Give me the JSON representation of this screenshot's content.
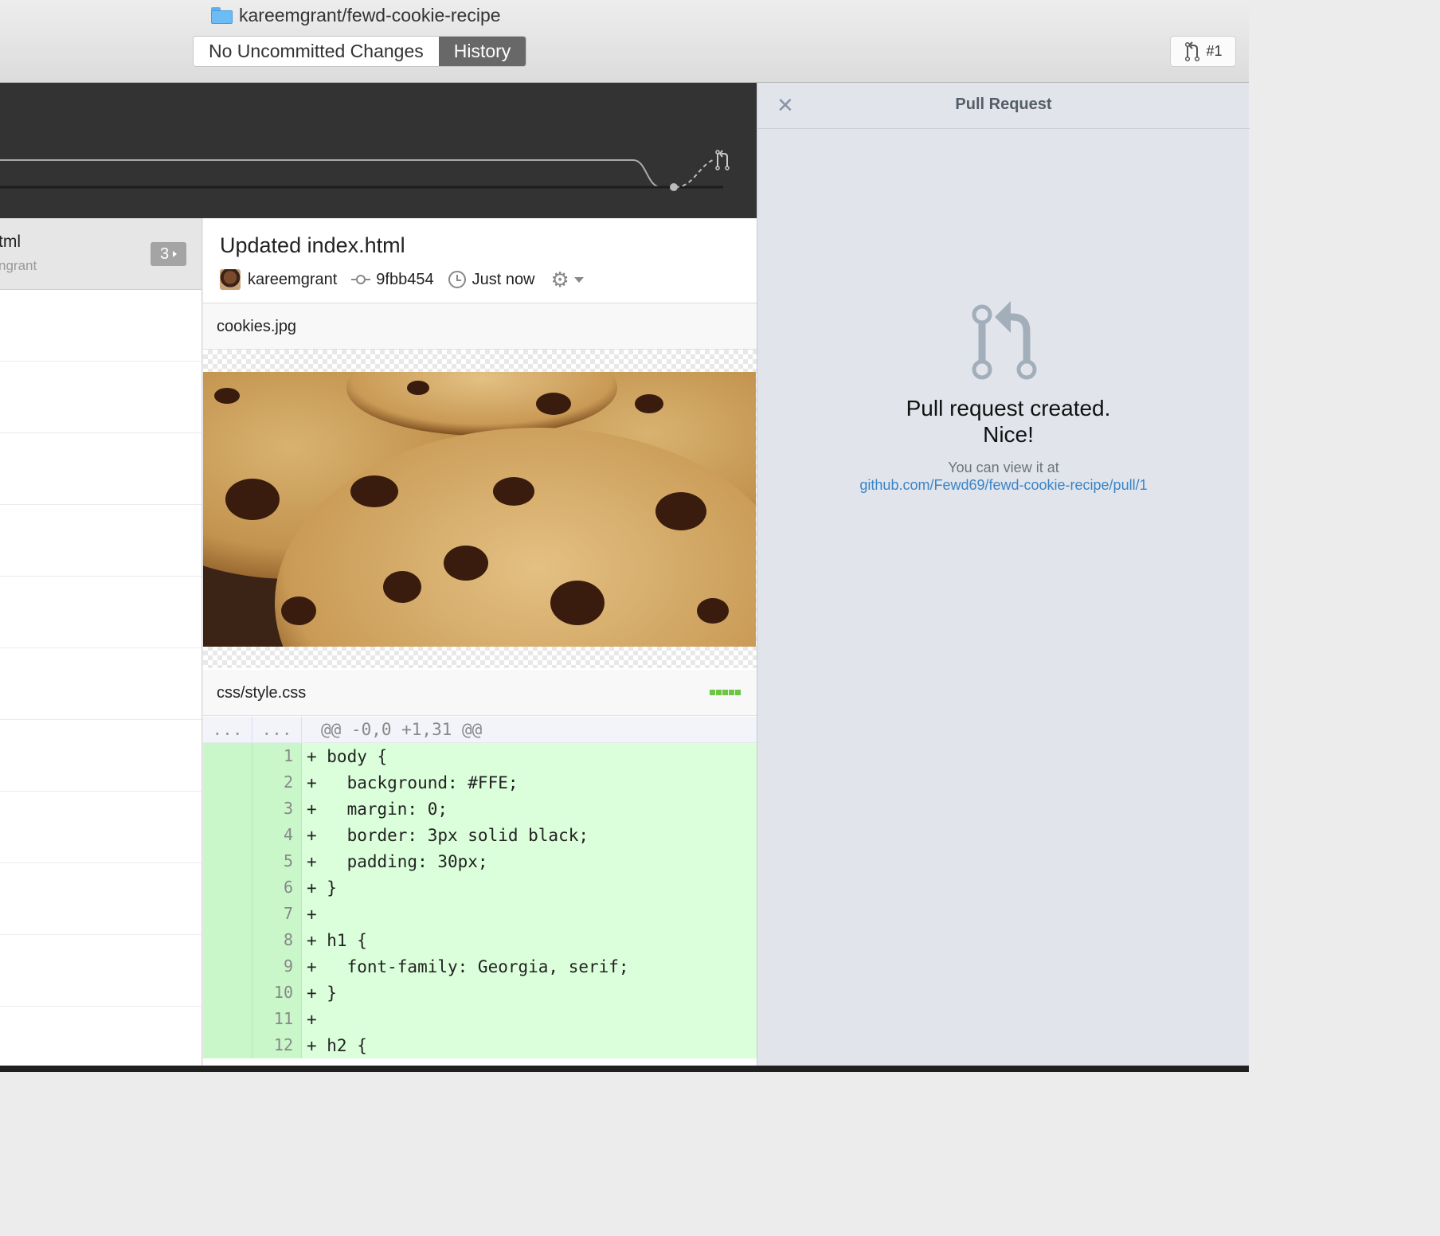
{
  "toolbar": {
    "repo_title": "kareemgrant/fewd-cookie-recipe",
    "tab_changes": "No Uncommitted Changes",
    "tab_history": "History",
    "pr_button_label": "#1"
  },
  "commit_list": {
    "selected_title": "tml",
    "selected_author": "ngrant",
    "file_count": "3"
  },
  "detail": {
    "title": "Updated index.html",
    "author": "kareemgrant",
    "sha": "9fbb454",
    "time": "Just now"
  },
  "files": [
    {
      "name": "cookies.jpg"
    },
    {
      "name": "css/style.css"
    }
  ],
  "diff": {
    "hunk_left": "...",
    "hunk_right": "...",
    "hunk_header": "@@ -0,0 +1,31 @@",
    "lines": [
      {
        "num": "1",
        "code": "+ body {"
      },
      {
        "num": "2",
        "code": "+   background: #FFE;"
      },
      {
        "num": "3",
        "code": "+   margin: 0;"
      },
      {
        "num": "4",
        "code": "+   border: 3px solid black;"
      },
      {
        "num": "5",
        "code": "+   padding: 30px;"
      },
      {
        "num": "6",
        "code": "+ }"
      },
      {
        "num": "7",
        "code": "+"
      },
      {
        "num": "8",
        "code": "+ h1 {"
      },
      {
        "num": "9",
        "code": "+   font-family: Georgia, serif;"
      },
      {
        "num": "10",
        "code": "+ }"
      },
      {
        "num": "11",
        "code": "+"
      },
      {
        "num": "12",
        "code": "+ h2 {"
      }
    ]
  },
  "pr_panel": {
    "title": "Pull Request",
    "message_line1": "Pull request created.",
    "message_line2": "Nice!",
    "sub": "You can view it at",
    "link": "github.com/Fewd69/fewd-cookie-recipe/pull/1"
  },
  "colors": {
    "accent_link": "#3a84c6",
    "diff_added_bg": "#dbffdb",
    "timeline_bg": "#333333",
    "history_tab_bg": "#686868"
  }
}
